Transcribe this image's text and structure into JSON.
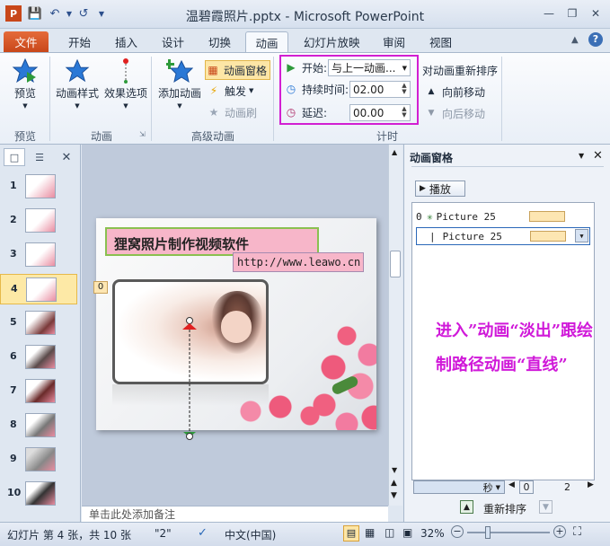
{
  "window": {
    "title": "温碧霞照片.pptx - Microsoft PowerPoint",
    "help_icon": "help-icon"
  },
  "tabs": [
    {
      "label": "文件",
      "name": "tab-file"
    },
    {
      "label": "开始",
      "name": "tab-home"
    },
    {
      "label": "插入",
      "name": "tab-insert"
    },
    {
      "label": "设计",
      "name": "tab-design"
    },
    {
      "label": "切换",
      "name": "tab-transitions"
    },
    {
      "label": "动画",
      "name": "tab-animations"
    },
    {
      "label": "幻灯片放映",
      "name": "tab-slideshow"
    },
    {
      "label": "审阅",
      "name": "tab-review"
    },
    {
      "label": "视图",
      "name": "tab-view"
    }
  ],
  "ribbon": {
    "preview": {
      "button": "预览",
      "group": "预览"
    },
    "animation": {
      "style_button": "动画样式",
      "effect_button": "效果选项",
      "group": "动画"
    },
    "advanced": {
      "add_button": "添加动画",
      "pane_button": "动画窗格",
      "trigger_button": "触发",
      "painter_button": "动画刷",
      "group": "高级动画"
    },
    "timing": {
      "start_label": "开始:",
      "start_value": "与上一动画...",
      "duration_label": "持续时间:",
      "duration_value": "02.00",
      "delay_label": "延迟:",
      "delay_value": "00.00",
      "reorder_label": "对动画重新排序",
      "move_earlier": "向前移动",
      "move_later": "向后移动",
      "group": "计时"
    }
  },
  "slides": [
    {
      "num": "1"
    },
    {
      "num": "2"
    },
    {
      "num": "3"
    },
    {
      "num": "4"
    },
    {
      "num": "5"
    },
    {
      "num": "6"
    },
    {
      "num": "7"
    },
    {
      "num": "8"
    },
    {
      "num": "9"
    },
    {
      "num": "10"
    }
  ],
  "selected_slide": "4",
  "slide": {
    "banner_text": "狸窝照片制作视频软件",
    "url_text": "http://www.leawo.cn",
    "anim_marker": "0"
  },
  "notes": {
    "placeholder": "单击此处添加备注"
  },
  "anim_pane": {
    "title": "动画窗格",
    "play_button": "播放",
    "items": [
      {
        "index": "0",
        "name": "Picture 25"
      },
      {
        "index": "",
        "name": "Picture 25"
      }
    ],
    "note": "进入”动画“淡出”跟绘制路径动画“直线”",
    "timeline_unit": "秒",
    "timeline_start": "0",
    "timeline_end": "2",
    "reorder_label": "重新排序"
  },
  "status": {
    "slide_info": "幻灯片 第 4 张，共 10 张",
    "theme": "\"2\"",
    "language": "中文(中国)",
    "zoom": "32%"
  },
  "colors": {
    "highlight_box": "#d21fd2",
    "note_text": "#d019d9",
    "file_tab": "#c8471a"
  }
}
